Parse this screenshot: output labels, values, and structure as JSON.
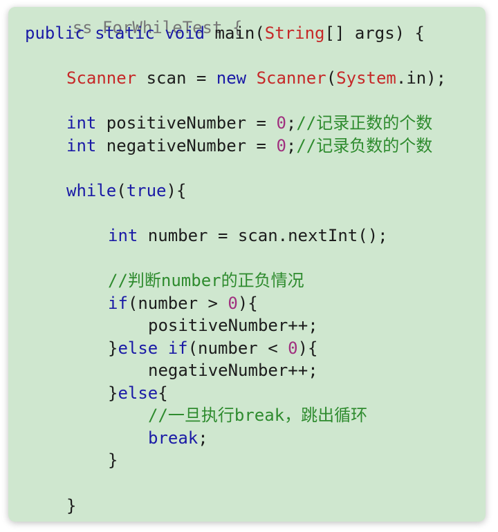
{
  "code": {
    "lines": {
      "l0": {
        "cut": "ss ForWhileTest {"
      },
      "l1": {
        "kw": "public static void",
        "a": " main(",
        "cls": "String",
        "b": "[] args) {"
      },
      "l2": {
        "cls1": "Scanner",
        "a": " scan = ",
        "kw": "new",
        "sp": " ",
        "cls2": "Scanner",
        "b": "(",
        "cls3": "System",
        "c": ".in);"
      },
      "l3": {
        "kw": "int",
        "a": " positiveNumber = ",
        "num": "0",
        "b": ";",
        "cmt": "//记录正数的个数"
      },
      "l4": {
        "kw": "int",
        "a": " negativeNumber = ",
        "num": "0",
        "b": ";",
        "cmt": "//记录负数的个数"
      },
      "l5": {
        "kw": "while",
        "a": "(",
        "kw2": "true",
        "b": "){"
      },
      "l6": {
        "kw": "int",
        "a": " number = scan.nextInt();"
      },
      "l7": {
        "cmt": "//判断number的正负情况"
      },
      "l8": {
        "kw": "if",
        "a": "(number > ",
        "num": "0",
        "b": "){"
      },
      "l9": {
        "a": "positiveNumber++;"
      },
      "l10": {
        "a": "}",
        "kw": "else if",
        "b": "(number < ",
        "num": "0",
        "c": "){"
      },
      "l11": {
        "a": "negativeNumber++;"
      },
      "l12": {
        "a": "}",
        "kw": "else",
        "b": "{"
      },
      "l13": {
        "cmt": "//一旦执行break，跳出循环"
      },
      "l14": {
        "kw": "break",
        "a": ";"
      },
      "l15": {
        "a": "}"
      },
      "l16": {
        "a": "}"
      }
    }
  }
}
